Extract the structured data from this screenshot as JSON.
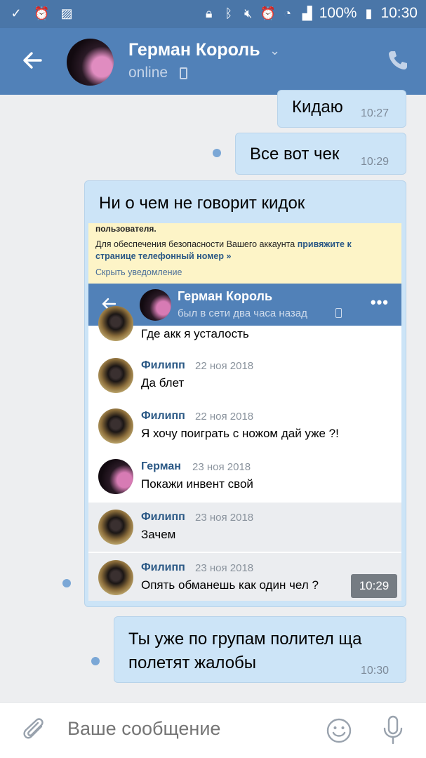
{
  "status_bar": {
    "battery": "100%",
    "time": "10:30",
    "icons": [
      "check-icon",
      "alarm-icon",
      "image-icon",
      "lock-icon",
      "bluetooth-icon",
      "mute-icon",
      "alarm-icon",
      "wifi-icon",
      "signal-icon",
      "battery-icon"
    ]
  },
  "header": {
    "name": "Герман Король",
    "status": "online",
    "colors": {
      "accent": "#5181b8",
      "statusbar": "#4a76a8"
    }
  },
  "messages": [
    {
      "text": "Кидаю",
      "time": "10:27"
    },
    {
      "text": "Все вот чек",
      "time": "10:29"
    },
    {
      "text": "Ни о чем не говорит кидок",
      "time": "10:29"
    },
    {
      "text_line1": "Ты уже по групам полител ща",
      "text_line2": "полетят жалобы",
      "time": "10:30"
    }
  ],
  "embedded": {
    "notice": {
      "title": "пользователя.",
      "text": "Для обеспечения безопасности Вашего аккаунта",
      "link": "привяжите к странице телефонный номер »",
      "hide": "Скрыть уведомление"
    },
    "header": {
      "name": "Герман Король",
      "status": "был в сети два часа назад",
      "more": "•••"
    },
    "rows": [
      {
        "name": "",
        "date": "",
        "text": "Где акк я усталость"
      },
      {
        "name": "Филипп",
        "date": "22 ноя 2018",
        "text": "Да блет"
      },
      {
        "name": "Филипп",
        "date": "22 ноя 2018",
        "text": "Я хочу поиграть с ножом дай уже ?!"
      },
      {
        "name": "Герман",
        "date": "23 ноя 2018",
        "text": "Покажи инвент свой"
      },
      {
        "name": "Филипп",
        "date": "23 ноя 2018",
        "text": "Зачем"
      },
      {
        "name": "Филипп",
        "date": "23 ноя 2018",
        "text": "Опять обманешь как один чел ?"
      }
    ]
  },
  "input": {
    "placeholder": "Ваше сообщение"
  }
}
